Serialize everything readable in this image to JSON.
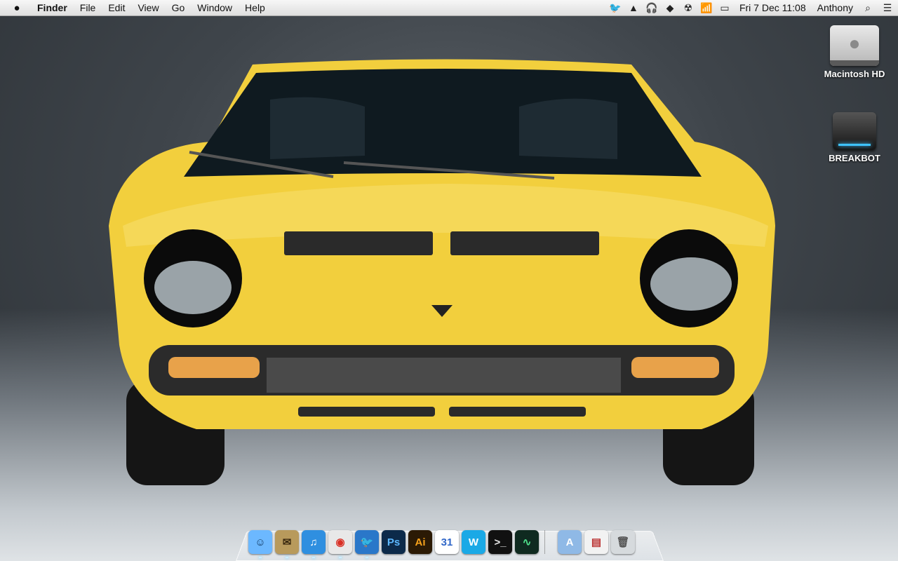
{
  "menubar": {
    "apple_icon": "apple-logo",
    "app_name": "Finder",
    "menus": [
      "File",
      "Edit",
      "View",
      "Go",
      "Window",
      "Help"
    ],
    "status_icons": [
      "twitter-icon",
      "google-drive-icon",
      "headphones-icon",
      "dropbox-icon",
      "radiation-icon",
      "wifi-icon",
      "battery-icon"
    ],
    "clock": "Fri 7 Dec  11:08",
    "user": "Anthony"
  },
  "desktop": {
    "icons": [
      {
        "label": "Macintosh HD",
        "icon": "hard-drive-icon"
      },
      {
        "label": "BREAKBOT",
        "icon": "external-drive-icon"
      }
    ]
  },
  "dock": {
    "apps": [
      {
        "icon": "finder-icon",
        "glyph": "☺",
        "bg": "#6cb8ff",
        "fg": "#10365e"
      },
      {
        "icon": "mail-stamp-icon",
        "glyph": "✉",
        "bg": "#b89a5c",
        "fg": "#3b2a10"
      },
      {
        "icon": "itunes-icon",
        "glyph": "♫",
        "bg": "#2f8fe0",
        "fg": "#ffffff"
      },
      {
        "icon": "chrome-icon",
        "glyph": "◉",
        "bg": "#e8e8e8",
        "fg": "#d93025"
      },
      {
        "icon": "tweetbot-icon",
        "glyph": "🐦",
        "bg": "#2a77c9",
        "fg": "#ffffff"
      },
      {
        "icon": "photoshop-icon",
        "glyph": "Ps",
        "bg": "#0c2a4a",
        "fg": "#5db8ff"
      },
      {
        "icon": "illustrator-icon",
        "glyph": "Ai",
        "bg": "#2b1a05",
        "fg": "#f7a21b"
      },
      {
        "icon": "calendar-icon",
        "glyph": "31",
        "bg": "#ffffff",
        "fg": "#2f66c8"
      },
      {
        "icon": "word-icon",
        "glyph": "W",
        "bg": "#1aa9e6",
        "fg": "#ffffff"
      },
      {
        "icon": "terminal-icon",
        "glyph": ">_",
        "bg": "#111111",
        "fg": "#e8e8e8"
      },
      {
        "icon": "activity-monitor-icon",
        "glyph": "∿",
        "bg": "#0f2a20",
        "fg": "#4fe08a"
      }
    ],
    "stacks": [
      {
        "icon": "applications-folder-icon",
        "glyph": "A",
        "bg": "#8fb9e6",
        "fg": "#ffffff"
      },
      {
        "icon": "downloads-stack-icon",
        "glyph": "▤",
        "bg": "#f2f2f2",
        "fg": "#b33"
      },
      {
        "icon": "trash-icon",
        "glyph": "🗑",
        "bg": "#d6dadd",
        "fg": "#555"
      }
    ]
  }
}
